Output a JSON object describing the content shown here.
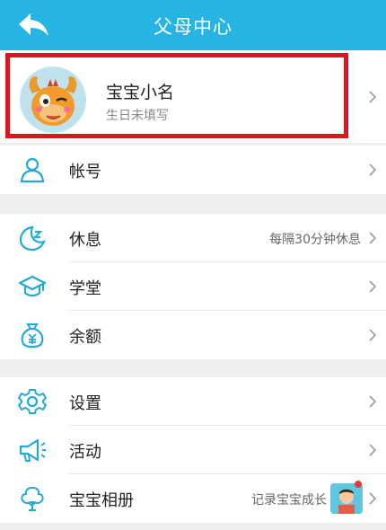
{
  "header": {
    "title": "父母中心"
  },
  "profile": {
    "name": "宝宝小名",
    "birthday": "生日未填写"
  },
  "account": {
    "label": "帐号"
  },
  "menu_group_1": [
    {
      "label": "休息",
      "value": "每隔30分钟休息"
    },
    {
      "label": "学堂",
      "value": ""
    },
    {
      "label": "余额",
      "value": ""
    }
  ],
  "menu_group_2": [
    {
      "label": "设置",
      "value": ""
    },
    {
      "label": "活动",
      "value": ""
    },
    {
      "label": "宝宝相册",
      "value": "记录宝宝成长"
    }
  ],
  "colors": {
    "accent": "#26b5e3",
    "highlight_border": "#e0141e",
    "icon": "#21a9d8"
  }
}
